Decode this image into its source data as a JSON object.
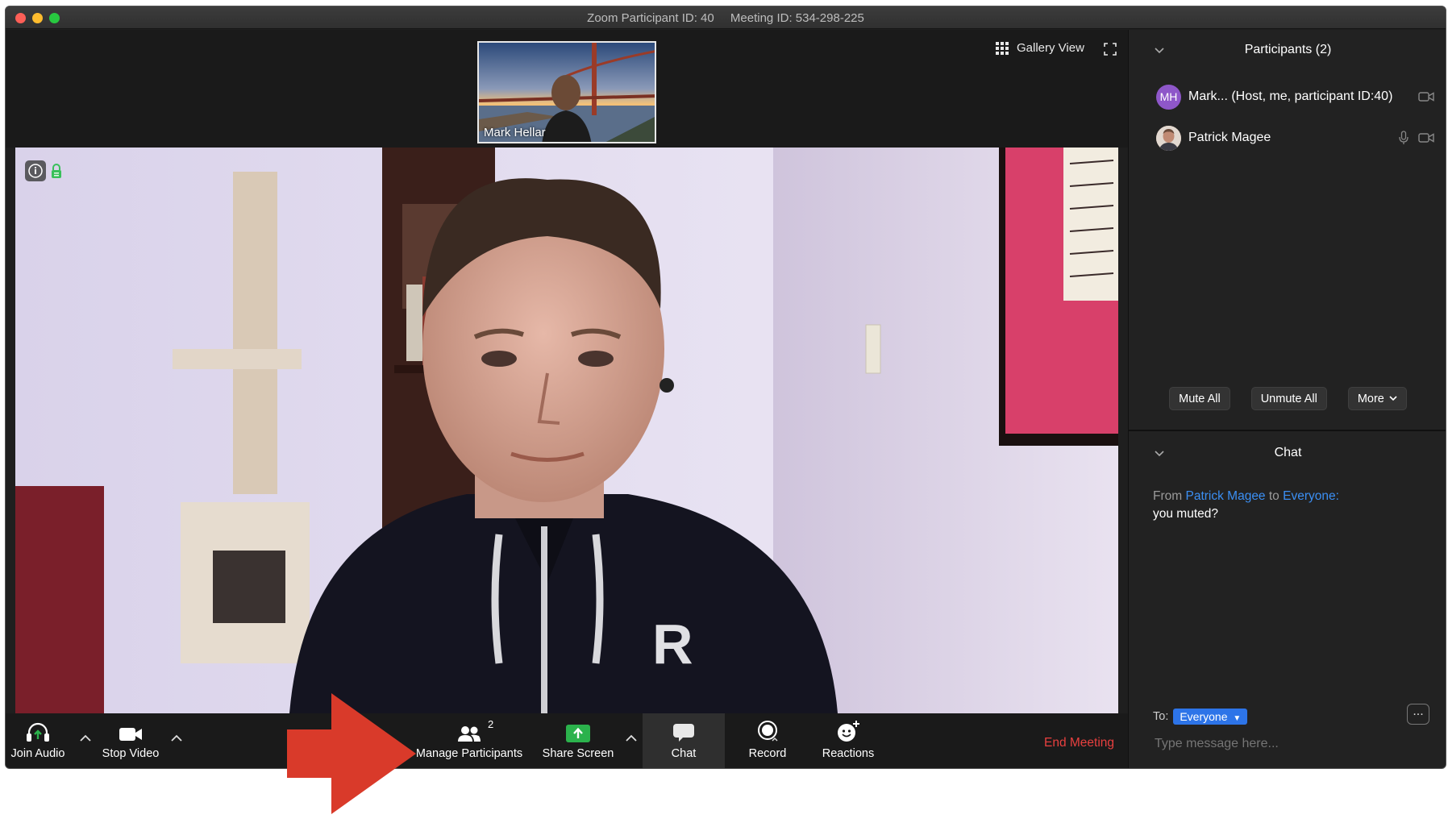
{
  "window": {
    "title_participant": "Zoom Participant ID: 40",
    "title_meeting": "Meeting ID: 534-298-225",
    "lights": {
      "close": "#fe5f57",
      "minimize": "#febc2e",
      "zoom": "#28c840"
    }
  },
  "thumbnail": {
    "name": "Mark Hellar"
  },
  "view": {
    "gallery_label": "Gallery View"
  },
  "toolbar": {
    "join_audio": "Join Audio",
    "stop_video": "Stop Video",
    "manage_participants": "Manage Participants",
    "participants_count": "2",
    "share_screen": "Share Screen",
    "chat": "Chat",
    "record": "Record",
    "reactions": "Reactions",
    "end_meeting": "End Meeting"
  },
  "participants": {
    "header": "Participants (2)",
    "list": [
      {
        "initials": "MH",
        "name": "Mark... (Host, me, participant ID:40)",
        "avatar_color": "#8e57c9"
      },
      {
        "initials": "",
        "name": "Patrick Magee"
      }
    ],
    "mute_all": "Mute All",
    "unmute_all": "Unmute All",
    "more": "More"
  },
  "chat": {
    "header": "Chat",
    "from_prefix": "From",
    "from_name": "Patrick Magee",
    "to_word": "to",
    "to_name": "Everyone:",
    "message": "you muted?",
    "to_label": "To:",
    "recipient": "Everyone",
    "placeholder": "Type message here...",
    "more_dots": "..."
  },
  "colors": {
    "end_meeting": "#e8403f",
    "link": "#3b8ff4",
    "share_green": "#2bb24c",
    "annotation_arrow": "#d93a2a"
  }
}
